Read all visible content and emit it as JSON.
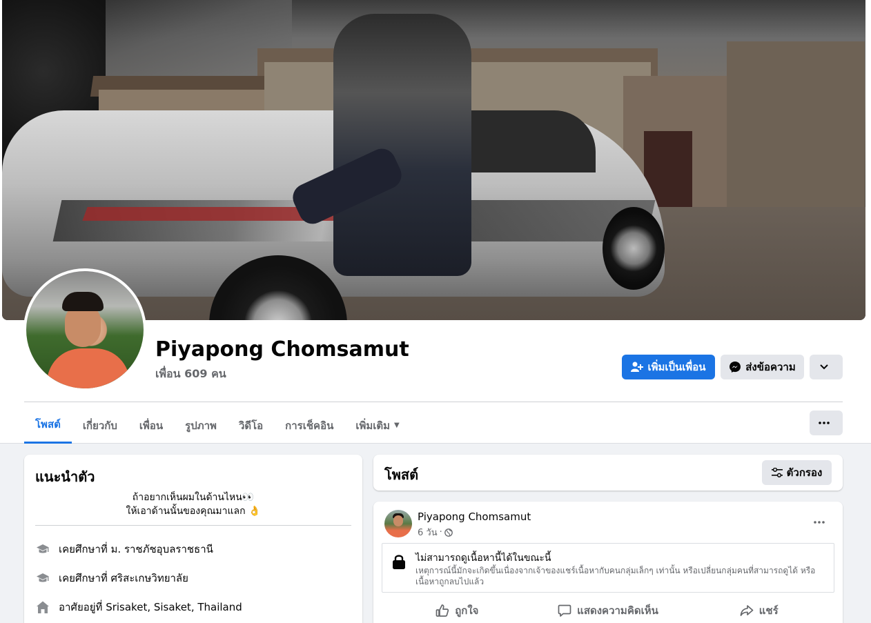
{
  "profile": {
    "name": "Piyapong Chomsamut",
    "friends": "เพื่อน 609 คน",
    "buttons": {
      "add_friend": "เพิ่มเป็นเพื่อน",
      "message": "ส่งข้อความ"
    }
  },
  "tabs": [
    {
      "label": "โพสต์",
      "active": true
    },
    {
      "label": "เกี่ยวกับ",
      "active": false
    },
    {
      "label": "เพื่อน",
      "active": false
    },
    {
      "label": "รูปภาพ",
      "active": false
    },
    {
      "label": "วิดีโอ",
      "active": false
    },
    {
      "label": "การเช็คอิน",
      "active": false
    },
    {
      "label": "เพิ่มเติม",
      "active": false
    }
  ],
  "intro": {
    "title": "แนะนำตัว",
    "bio_line1": "ถ้าอยากเห็นผมในด้านไหน👀",
    "bio_line2": "ให้เอาด้านนั้นของคุณมาแลก 👌",
    "items": [
      {
        "icon": "graduation-cap-icon",
        "text": "เคยศึกษาที่ ม. ราชภัชอุบลราชธานี"
      },
      {
        "icon": "graduation-cap-icon",
        "text": "เคยศึกษาที่ ศริสะเกษวิทยาลัย"
      },
      {
        "icon": "home-icon",
        "text": "อาศัยอยู่ที่ Srisaket, Sisaket, Thailand"
      }
    ]
  },
  "posts_header": {
    "title": "โพสต์",
    "filter_label": "ตัวกรอง"
  },
  "post": {
    "author": "Piyapong Chomsamut",
    "time": "6 วัน",
    "privacy_icon": "globe-icon",
    "notice_title": "ไม่สามารถดูเนื้อหานี้ได้ในขณะนี้",
    "notice_desc": "เหตุการณ์นี้มักจะเกิดขึ้นเนื่องจากเจ้าของแชร์เนื้อหากับคนกลุ่มเล็กๆ เท่านั้น หรือเปลี่ยนกลุ่มคนที่สามารถดูได้ หรือเนื้อหาถูกลบไปแล้ว",
    "actions": {
      "like": "ถูกใจ",
      "comment": "แสดงความคิดเห็น",
      "share": "แชร์"
    }
  },
  "colors": {
    "primary": "#1b74e4",
    "secondary_text": "#65676b",
    "button_gray": "#e4e6eb",
    "page_bg": "#f0f2f5"
  }
}
